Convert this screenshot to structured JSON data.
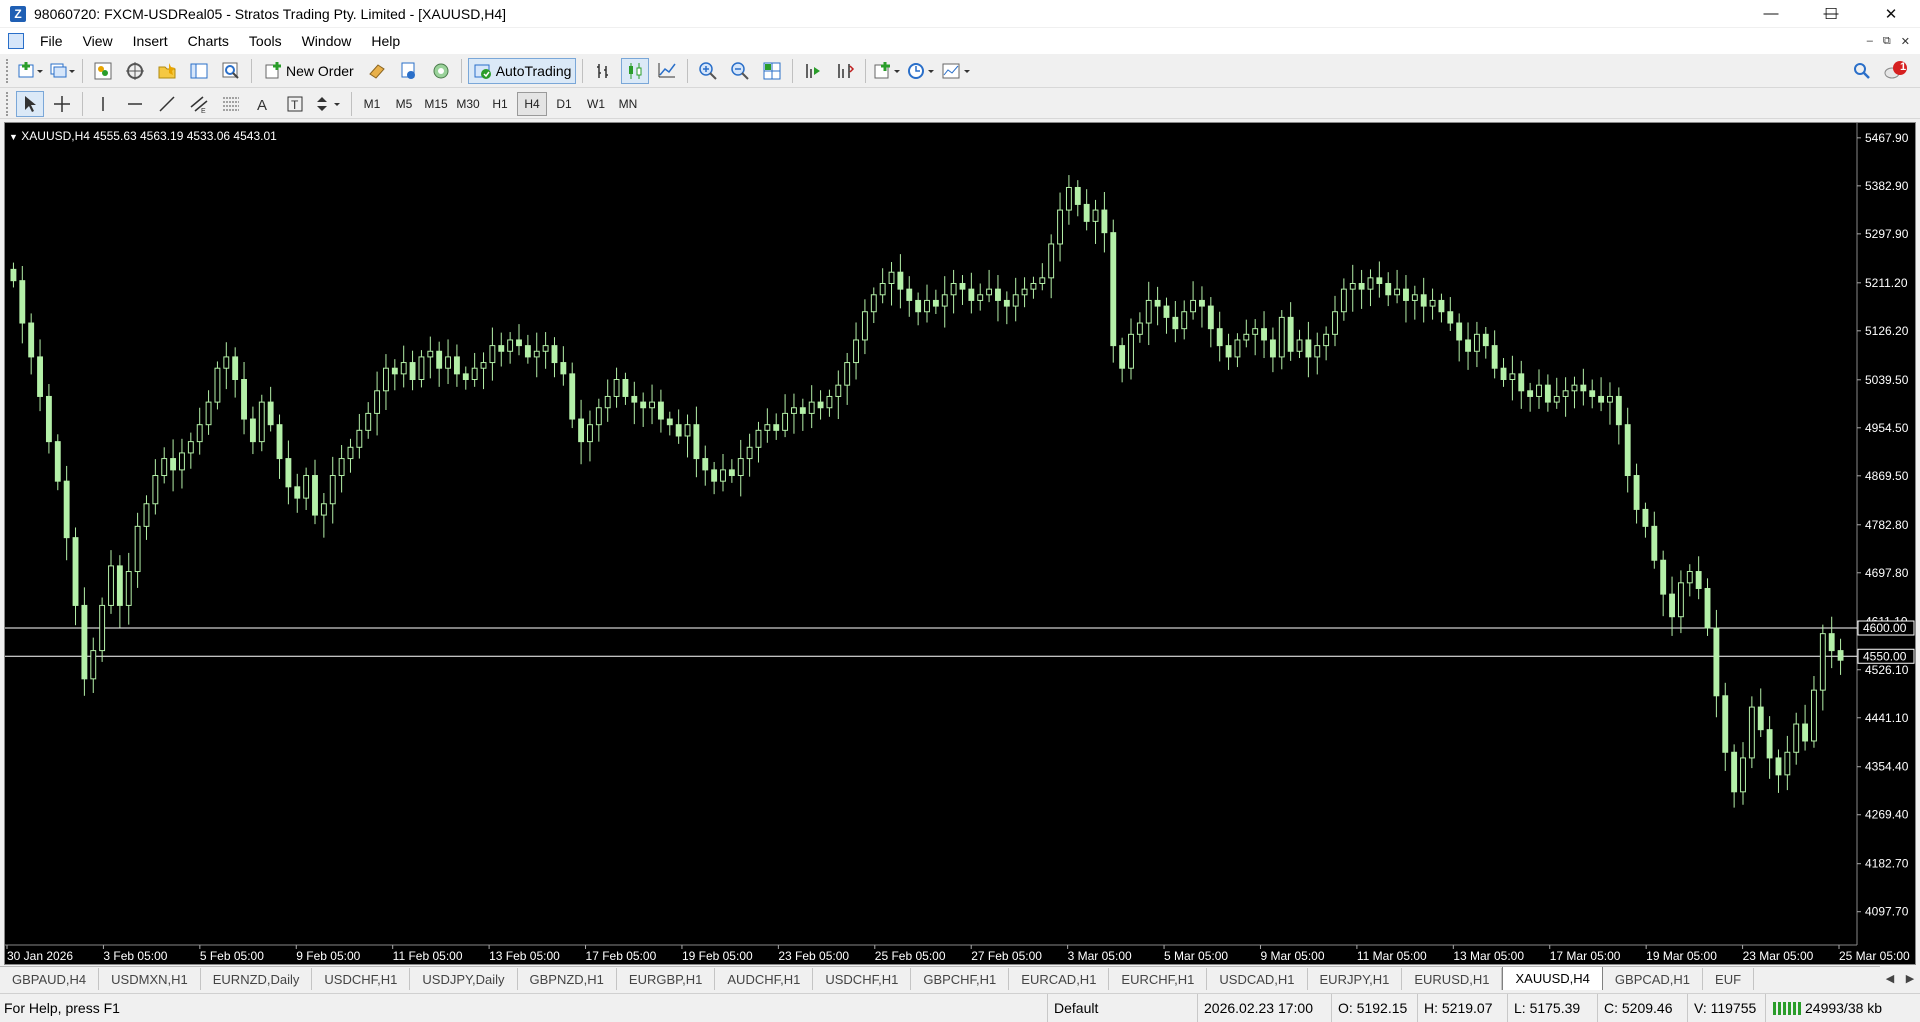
{
  "window": {
    "title": "98060720: FXCM-USDReal05 - Stratos Trading Pty. Limited - [XAUUSD,H4]",
    "app_icon": "Z",
    "minimize": "—",
    "maximize": "☐",
    "close": "✕"
  },
  "menu": {
    "items": [
      {
        "label": "File"
      },
      {
        "label": "View"
      },
      {
        "label": "Insert"
      },
      {
        "label": "Charts"
      },
      {
        "label": "Tools"
      },
      {
        "label": "Window"
      },
      {
        "label": "Help"
      }
    ],
    "mdi_minimize": "–",
    "mdi_restore": "⧉",
    "mdi_close": "✕"
  },
  "toolbar": {
    "new_order": "New Order",
    "autotrading": "AutoTrading",
    "notification_count": "1"
  },
  "timeframes": [
    "M1",
    "M5",
    "M15",
    "M30",
    "H1",
    "H4",
    "D1",
    "W1",
    "MN"
  ],
  "active_timeframe": "H4",
  "chart": {
    "symbol_label": "XAUUSD,H4  4555.63 4563.19 4533.06 4543.01",
    "colors": {
      "background": "#000000",
      "candle": "#b4f0a8",
      "axis_text": "#ffffff",
      "hline": "#ffffff"
    },
    "price_ticks": [
      "5467.90",
      "5382.90",
      "5297.90",
      "5211.20",
      "5126.20",
      "5039.50",
      "4954.50",
      "4869.50",
      "4782.80",
      "4697.80",
      "4611.10",
      "4526.10",
      "4441.10",
      "4354.40",
      "4269.40",
      "4182.70",
      "4097.70"
    ],
    "date_ticks": [
      "30 Jan 2026",
      "3 Feb 05:00",
      "5 Feb 05:00",
      "9 Feb 05:00",
      "11 Feb 05:00",
      "13 Feb 05:00",
      "17 Feb 05:00",
      "19 Feb 05:00",
      "23 Feb 05:00",
      "25 Feb 05:00",
      "27 Feb 05:00",
      "3 Mar 05:00",
      "5 Mar 05:00",
      "9 Mar 05:00",
      "11 Mar 05:00",
      "13 Mar 05:00",
      "17 Mar 05:00",
      "19 Mar 05:00",
      "23 Mar 05:00",
      "25 Mar 05:00"
    ],
    "hlines": [
      {
        "price": 4600.0,
        "label": "4600.00"
      },
      {
        "price": 4550.0,
        "label": "4550.00"
      }
    ],
    "price_range": [
      4060,
      5480
    ],
    "closes": [
      5215,
      5140,
      5080,
      5010,
      4930,
      4860,
      4760,
      4640,
      4510,
      4560,
      4640,
      4710,
      4640,
      4700,
      4780,
      4820,
      4870,
      4900,
      4880,
      4910,
      4930,
      4960,
      5000,
      5060,
      5080,
      5040,
      4970,
      4930,
      5000,
      4960,
      4900,
      4850,
      4830,
      4870,
      4800,
      4820,
      4870,
      4900,
      4920,
      4950,
      4980,
      5020,
      5060,
      5050,
      5070,
      5040,
      5080,
      5090,
      5060,
      5080,
      5050,
      5040,
      5060,
      5070,
      5100,
      5090,
      5110,
      5100,
      5080,
      5090,
      5100,
      5070,
      5050,
      4970,
      4930,
      4960,
      4990,
      5010,
      5040,
      5010,
      5000,
      4990,
      5000,
      4970,
      4960,
      4940,
      4960,
      4900,
      4880,
      4860,
      4880,
      4870,
      4900,
      4920,
      4950,
      4960,
      4950,
      4980,
      4990,
      4980,
      5000,
      4990,
      5010,
      5030,
      5070,
      5110,
      5160,
      5190,
      5210,
      5230,
      5200,
      5180,
      5160,
      5180,
      5170,
      5190,
      5210,
      5200,
      5180,
      5190,
      5200,
      5180,
      5170,
      5190,
      5200,
      5210,
      5220,
      5280,
      5340,
      5380,
      5350,
      5320,
      5340,
      5300,
      5100,
      5060,
      5120,
      5140,
      5180,
      5170,
      5150,
      5130,
      5160,
      5180,
      5170,
      5130,
      5100,
      5080,
      5110,
      5120,
      5130,
      5110,
      5080,
      5150,
      5090,
      5110,
      5080,
      5100,
      5120,
      5160,
      5200,
      5210,
      5200,
      5220,
      5210,
      5190,
      5200,
      5180,
      5190,
      5170,
      5180,
      5160,
      5140,
      5110,
      5090,
      5120,
      5100,
      5060,
      5040,
      5050,
      5020,
      5010,
      5030,
      5000,
      5010,
      5020,
      5030,
      5020,
      5010,
      5000,
      5010,
      4960,
      4870,
      4810,
      4780,
      4720,
      4660,
      4620,
      4680,
      4700,
      4670,
      4600,
      4480,
      4380,
      4310,
      4370,
      4460,
      4420,
      4370,
      4340,
      4380,
      4430,
      4400,
      4490,
      4590,
      4560,
      4543
    ]
  },
  "tabs": [
    {
      "label": "GBPAUD,H4"
    },
    {
      "label": "USDMXN,H1"
    },
    {
      "label": "EURNZD,Daily"
    },
    {
      "label": "USDCHF,H1"
    },
    {
      "label": "USDJPY,Daily"
    },
    {
      "label": "GBPNZD,H1"
    },
    {
      "label": "EURGBP,H1"
    },
    {
      "label": "AUDCHF,H1"
    },
    {
      "label": "USDCHF,H1"
    },
    {
      "label": "GBPCHF,H1"
    },
    {
      "label": "EURCAD,H1"
    },
    {
      "label": "EURCHF,H1"
    },
    {
      "label": "USDCAD,H1"
    },
    {
      "label": "EURJPY,H1"
    },
    {
      "label": "EURUSD,H1"
    },
    {
      "label": "XAUUSD,H4"
    },
    {
      "label": "GBPCAD,H1"
    },
    {
      "label": "EUF"
    }
  ],
  "active_tab": "XAUUSD,H4",
  "status": {
    "help": "For Help, press F1",
    "profile": "Default",
    "datetime": "2026.02.23 17:00",
    "open": "O: 5192.15",
    "high": "H: 5219.07",
    "low": "L: 5175.39",
    "close": "C: 5209.46",
    "volume": "V: 119755",
    "traffic": "24993/38 kb"
  }
}
